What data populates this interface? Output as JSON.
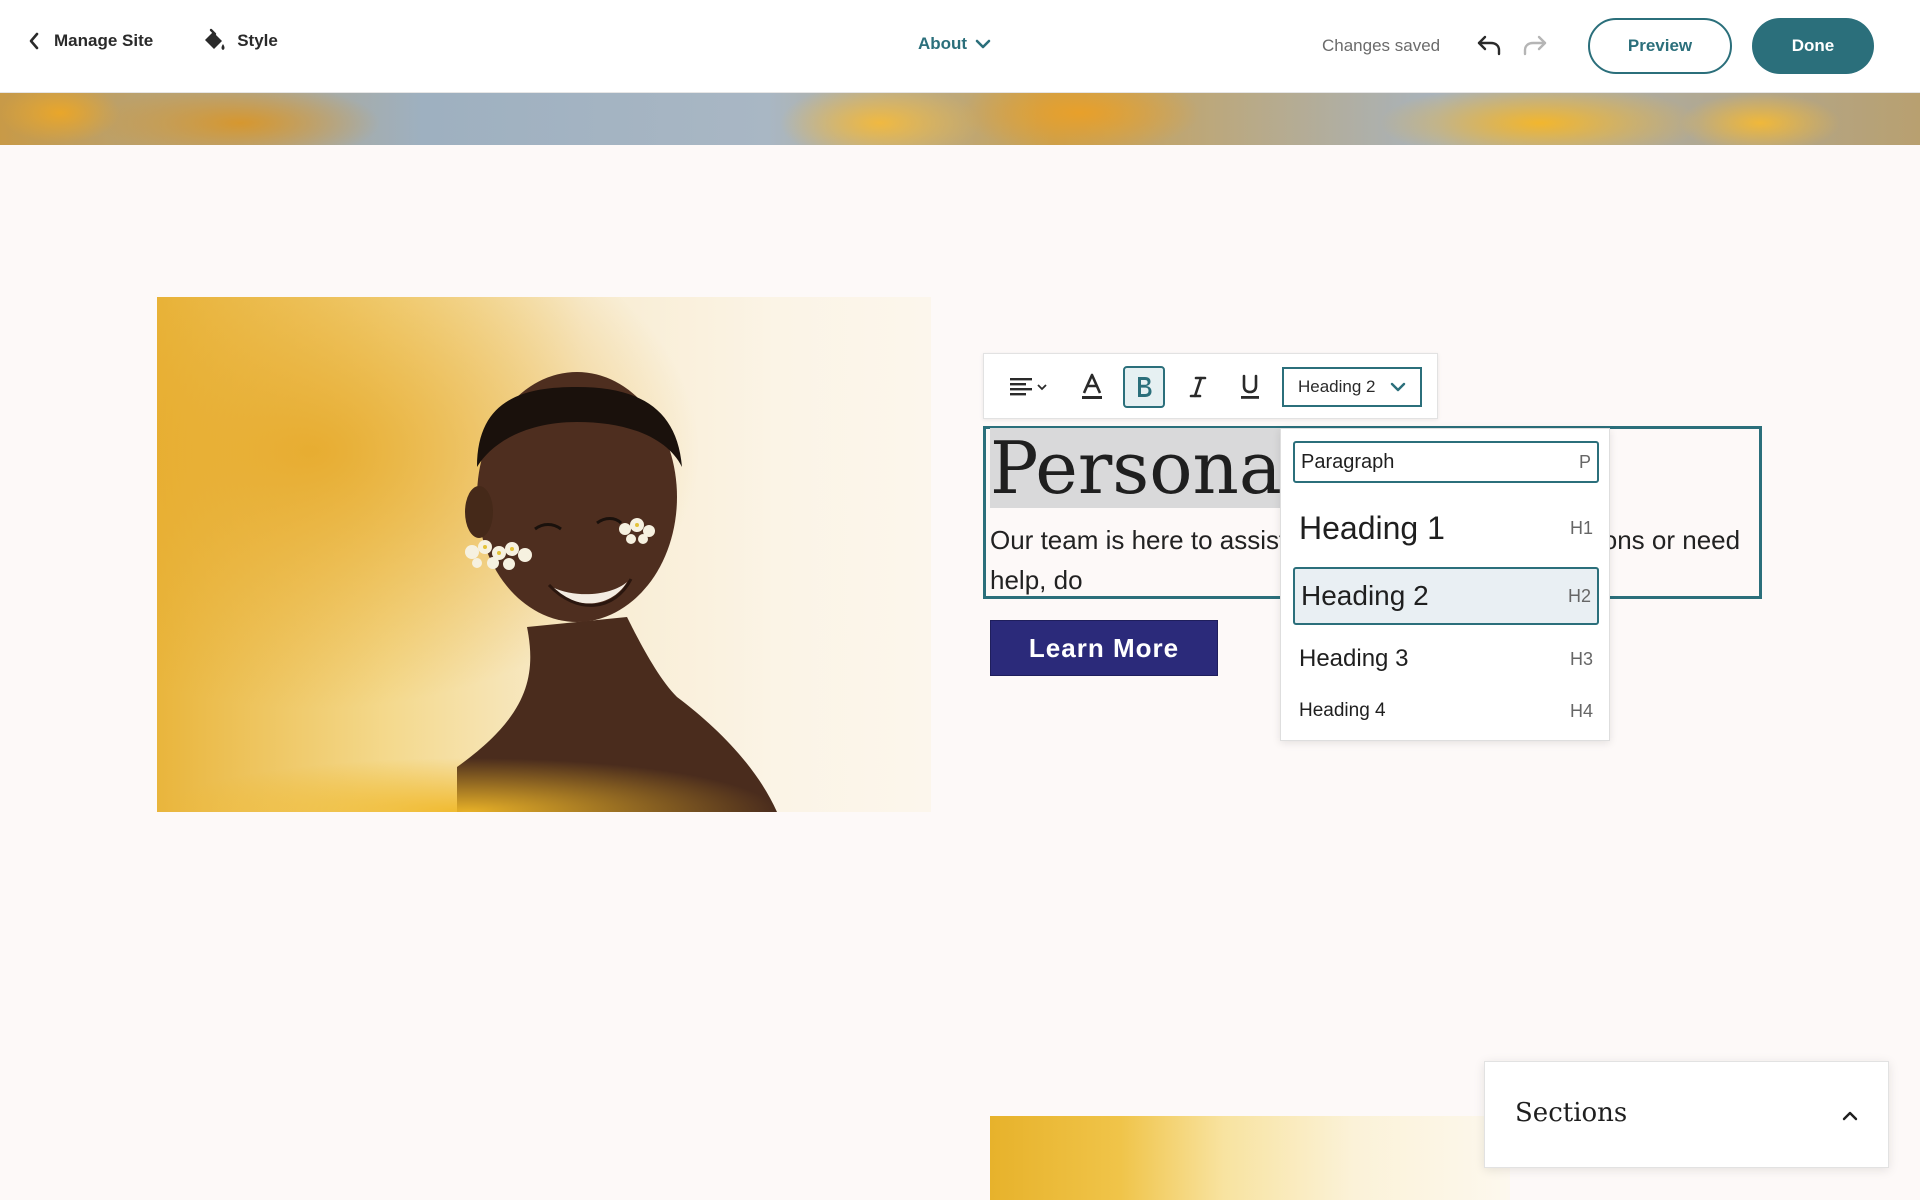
{
  "topbar": {
    "manage_site_label": "Manage Site",
    "style_label": "Style",
    "current_page": "About",
    "status_text": "Changes saved",
    "preview_label": "Preview",
    "done_label": "Done"
  },
  "toolbar": {
    "align_icon": "align-left-icon",
    "text_color_icon": "text-color-icon",
    "bold_icon": "bold-icon",
    "bold_active": true,
    "italic_icon": "italic-icon",
    "underline_icon": "underline-icon",
    "selected_style": "Heading 2"
  },
  "content": {
    "heading": "Personalize",
    "body": "Our team is here to assist you. If you have any questions or need help, do",
    "button_label": "Learn More"
  },
  "style_dropdown": {
    "options": [
      {
        "label": "Paragraph",
        "tag": "P",
        "focused": true
      },
      {
        "label": "Heading 1",
        "tag": "H1"
      },
      {
        "label": "Heading 2",
        "tag": "H2",
        "selected": true
      },
      {
        "label": "Heading 3",
        "tag": "H3"
      },
      {
        "label": "Heading 4",
        "tag": "H4"
      }
    ]
  },
  "sections_panel": {
    "title": "Sections",
    "state": "collapsed"
  },
  "colors": {
    "accent": "#2b6f7b",
    "button_bg": "#2b2a7a",
    "page_bg": "#fdf9f8"
  }
}
